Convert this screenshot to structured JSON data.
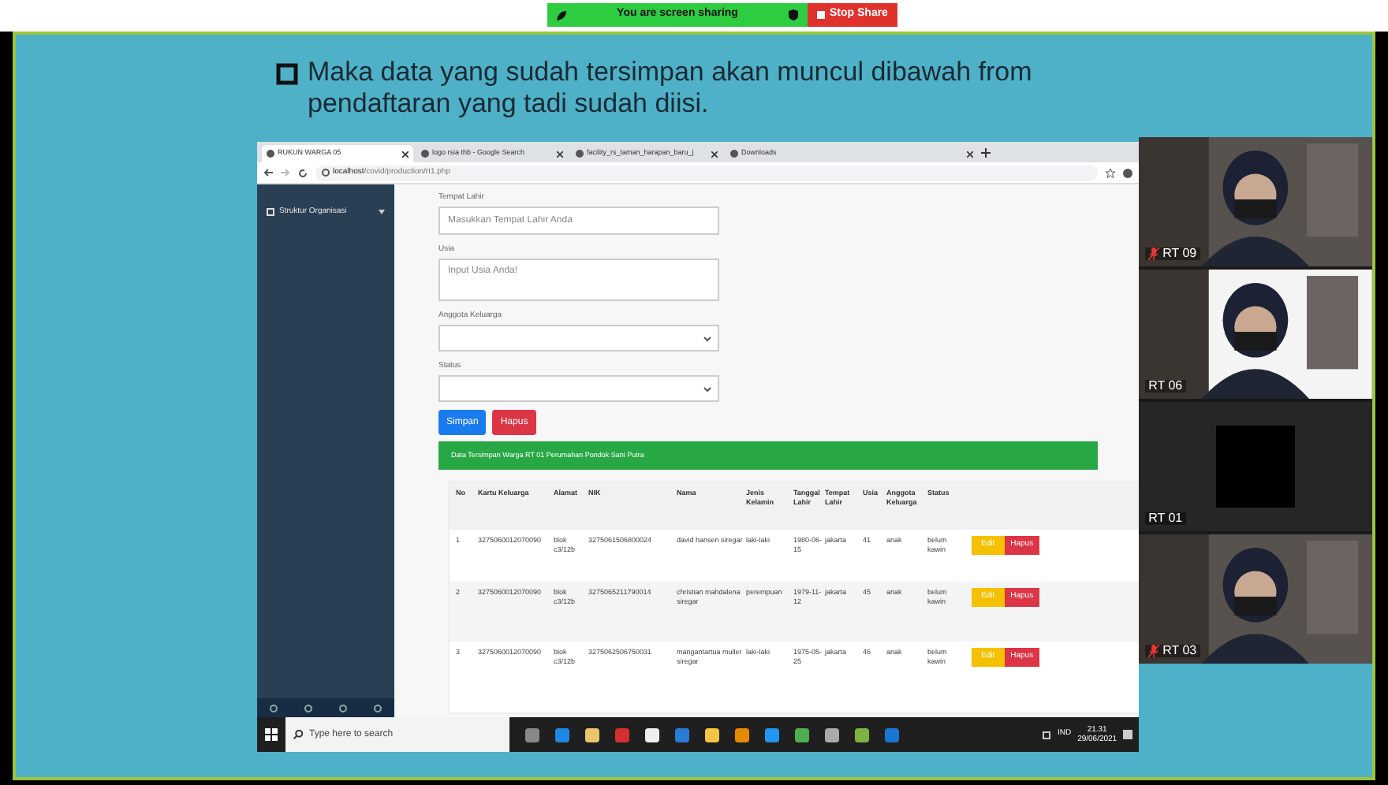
{
  "share_bar": {
    "status": "You are screen sharing",
    "stop": "Stop Share"
  },
  "slide": {
    "bullet": "Maka data yang sudah tersimpan akan muncul dibawah from pendaftaran yang tadi sudah diisi."
  },
  "browser": {
    "tabs": [
      {
        "title": "RUKUN WARGA 05",
        "selected": true
      },
      {
        "title": "logo rsia thb - Google Search",
        "selected": false
      },
      {
        "title": "facility_rs_taman_harapan_baru_j",
        "selected": false
      },
      {
        "title": "Downloads",
        "selected": false
      }
    ],
    "url_host": "localhost",
    "url_path": "/covid/production/rt1.php"
  },
  "sidebar": {
    "items": [
      {
        "label": "Struktur Organisasi"
      }
    ]
  },
  "form": {
    "fields": [
      {
        "kind": "input",
        "label": "Tempat Lahir",
        "placeholder": "Masukkan Tempat Lahir Anda"
      },
      {
        "kind": "textarea",
        "label": "Usia",
        "placeholder": "Input Usia Anda!"
      },
      {
        "kind": "select",
        "label": "Anggota Keluarga"
      },
      {
        "kind": "select",
        "label": "Status"
      }
    ],
    "buttons": [
      {
        "label": "Simpan",
        "kind": "primary"
      },
      {
        "label": "Hapus",
        "kind": "danger"
      }
    ]
  },
  "banner": "Data Tersimpan Warga RT 01 Perumahan Pondok Sani Putra",
  "table": {
    "columns": [
      "No",
      "Kartu Keluarga",
      "Alamat",
      "NIK",
      "Nama",
      "Jenis Kelamin",
      "Tanggal Lahir",
      "Tempat Lahir",
      "Usia",
      "Anggota Keluarga",
      "Status"
    ],
    "rows": [
      {
        "cells": [
          "1",
          "3275060012070090",
          "blok c3/12b",
          "3275061506800024",
          "david hansen siregar",
          "laki-laki",
          "1980-06-15",
          "jakarta",
          "41",
          "anak",
          "belum kawin"
        ],
        "edit": "Edit",
        "delete": "Hapus"
      },
      {
        "cells": [
          "2",
          "3275060012070090",
          "blok c3/12b",
          "3275065211790014",
          "christian mahdalena siregar",
          "perempuan",
          "1979-11-12",
          "jakarta",
          "45",
          "anak",
          "belum kawin"
        ],
        "edit": "Edit",
        "delete": "Hapus"
      },
      {
        "cells": [
          "3",
          "3275060012070090",
          "blok c3/12b",
          "3275062506750031",
          "mangantartua muller siregar",
          "laki-laki",
          "1975-05-25",
          "jakarta",
          "46",
          "anak",
          "belum kawin"
        ],
        "edit": "Edit",
        "delete": "Hapus"
      }
    ]
  },
  "taskbar": {
    "search_placeholder": "Type here to search",
    "lang": "IND",
    "time": "21.31",
    "date": "29/06/2021"
  },
  "participants": [
    {
      "name": "RT 09",
      "muted": true,
      "video": true
    },
    {
      "name": "RT 06",
      "muted": false,
      "video": true
    },
    {
      "name": "RT 01",
      "muted": false,
      "video": false
    },
    {
      "name": "RT 03",
      "muted": true,
      "video": true
    }
  ]
}
